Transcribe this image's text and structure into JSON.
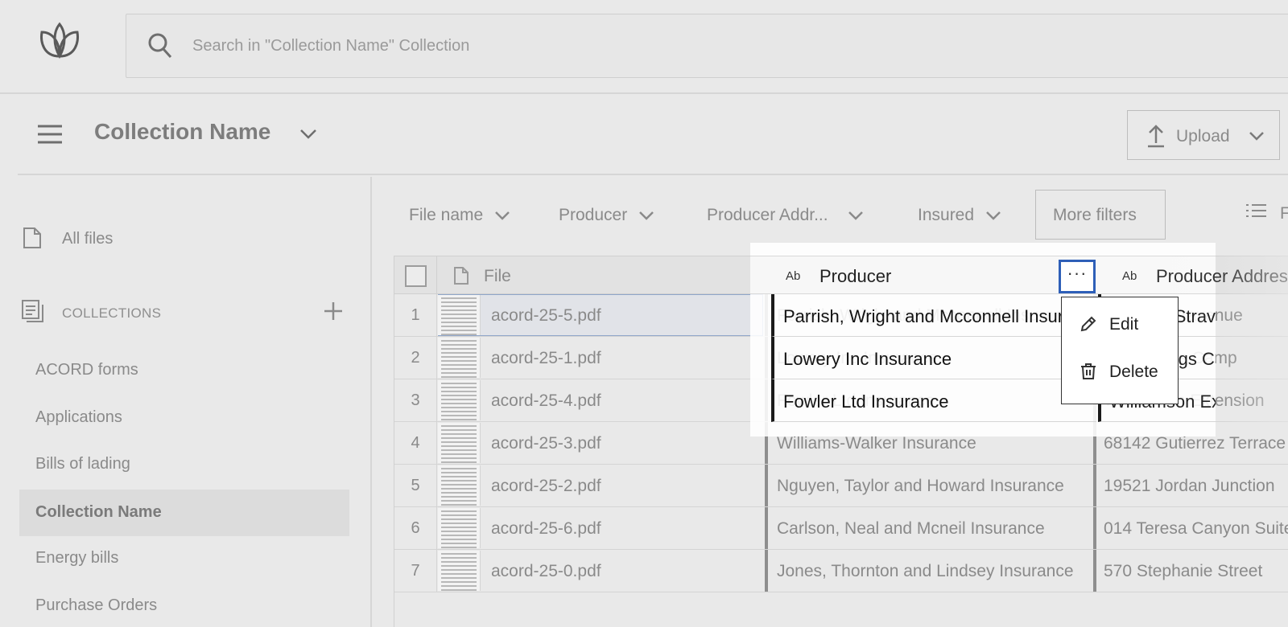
{
  "search": {
    "placeholder": "Search in \"Collection Name\" Collection"
  },
  "header": {
    "collection_title": "Collection Name",
    "upload_label": "Upload"
  },
  "sidebar": {
    "all_files": "All files",
    "collections_heading": "COLLECTIONS",
    "items": [
      {
        "label": "ACORD forms",
        "active": false
      },
      {
        "label": "Applications",
        "active": false
      },
      {
        "label": "Bills of lading",
        "active": false
      },
      {
        "label": "Collection Name",
        "active": true
      },
      {
        "label": "Energy bills",
        "active": false
      },
      {
        "label": "Purchase Orders",
        "active": false
      }
    ]
  },
  "filters": {
    "items": [
      "File name",
      "Producer",
      "Producer Addr...",
      "Insured"
    ],
    "more_filters": "More filters",
    "list_label": "F"
  },
  "table": {
    "columns": {
      "file": "File",
      "producer": "Producer",
      "producer_address": "Producer Address",
      "type_badge": "Ab"
    },
    "rows": [
      {
        "num": "1",
        "file": "acord-25-5.pdf",
        "producer": "Parrish, Wright and Mcconnell Insurance",
        "address": "Cynthia Stravenue"
      },
      {
        "num": "2",
        "file": "acord-25-1.pdf",
        "producer": "Lowery Inc Insurance",
        "address": "chell Burgs Camp"
      },
      {
        "num": "3",
        "file": "acord-25-4.pdf",
        "producer": "Fowler Ltd Insurance",
        "address": "Williamson Extension"
      },
      {
        "num": "4",
        "file": "acord-25-3.pdf",
        "producer": "Williams-Walker Insurance",
        "address": "68142 Gutierrez Terrace"
      },
      {
        "num": "5",
        "file": "acord-25-2.pdf",
        "producer": "Nguyen, Taylor and Howard Insurance",
        "address": "19521 Jordan Junction"
      },
      {
        "num": "6",
        "file": "acord-25-6.pdf",
        "producer": "Carlson, Neal and Mcneil Insurance",
        "address": "014 Teresa Canyon Suite"
      },
      {
        "num": "7",
        "file": "acord-25-0.pdf",
        "producer": "Jones, Thornton and Lindsey Insurance",
        "address": "570 Stephanie Street"
      }
    ]
  },
  "column_menu": {
    "edit": "Edit",
    "delete": "Delete",
    "kebab": "···"
  },
  "colors": {
    "accent_focus": "#2e5fb8",
    "background": "#e9e9e9"
  }
}
